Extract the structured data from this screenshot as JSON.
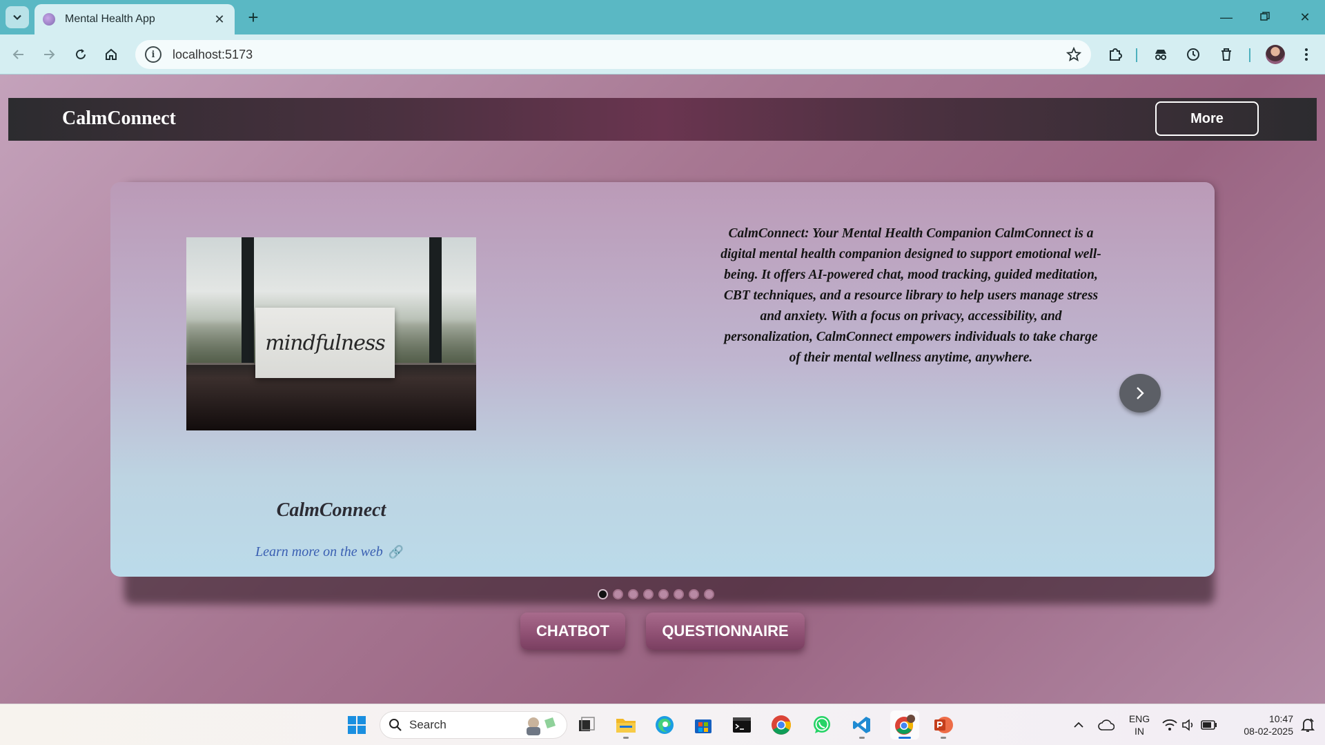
{
  "browser": {
    "tab_title": "Mental Health App",
    "url": "localhost:5173"
  },
  "app": {
    "brand": "CalmConnect",
    "more_label": "More"
  },
  "carousel": {
    "image_caption_text": "mindfulness",
    "description": "CalmConnect: Your Mental Health Companion CalmConnect is a digital mental health companion designed to support emotional well-being. It offers AI-powered chat, mood tracking, guided meditation, CBT techniques, and a resource library to help users manage stress and anxiety. With a focus on privacy, accessibility, and personalization, CalmConnect empowers individuals to take charge of their mental wellness anytime, anywhere.",
    "slide_title": "CalmConnect",
    "link_text": "Learn more on the web",
    "slide_count": 8,
    "active_slide": 1
  },
  "actions": {
    "chatbot_label": "CHATBOT",
    "questionnaire_label": "QUESTIONNAIRE"
  },
  "taskbar": {
    "search_placeholder": "Search",
    "language": "ENG",
    "region": "IN",
    "time": "10:47",
    "date": "08-02-2025"
  },
  "colors": {
    "tabbar": "#5ab8c4",
    "header_accent": "#6a3550",
    "button_accent": "#8e4f72",
    "link": "#3a5fb2"
  }
}
